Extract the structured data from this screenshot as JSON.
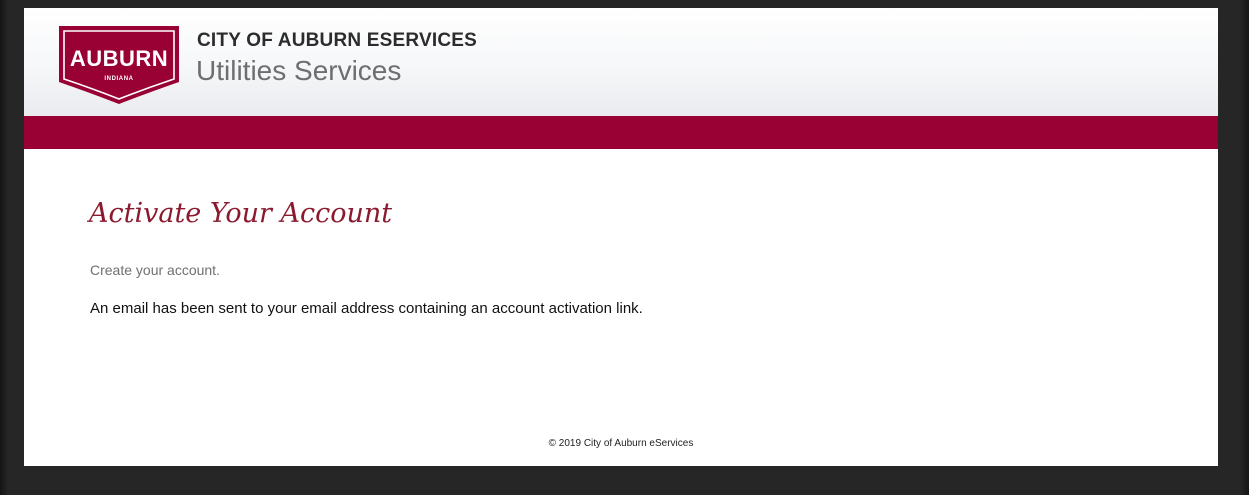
{
  "header": {
    "logo": {
      "icon": "city-of-auburn-logo",
      "text": "AUBURN",
      "subtext": "INDIANA"
    },
    "org_name": "CITY OF AUBURN ESERVICES",
    "service_name": "Utilities Services"
  },
  "main": {
    "title": "Activate Your Account",
    "subtitle": "Create your account.",
    "message": "An email has been sent to your email address containing an account activation link."
  },
  "footer": {
    "copyright": "© 2019 City of Auburn eServices"
  },
  "colors": {
    "brand": "#990033",
    "title": "#8b1a2e",
    "frame": "#262626"
  }
}
